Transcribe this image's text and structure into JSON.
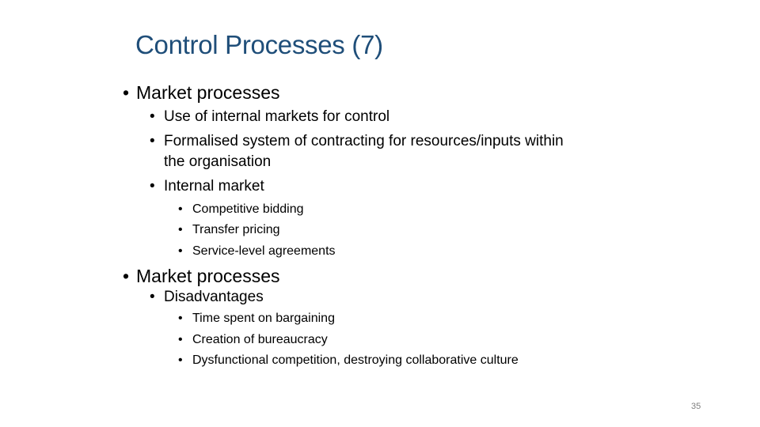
{
  "slide": {
    "title": "Control Processes (7)",
    "page_number": "35",
    "bullet_glyph": "•",
    "items": [
      {
        "level": 1,
        "text": "Market processes"
      },
      {
        "level": 2,
        "text": "Use of internal markets for control"
      },
      {
        "level": 2,
        "text": "Formalised system of contracting for resources/inputs within",
        "continuation": "the organisation"
      },
      {
        "level": 2,
        "text": "Internal market"
      },
      {
        "level": 3,
        "text": "Competitive bidding"
      },
      {
        "level": 3,
        "text": "Transfer pricing"
      },
      {
        "level": 3,
        "text": "Service-level agreements"
      },
      {
        "level": 1,
        "text": "Market processes"
      },
      {
        "level": 2,
        "text": "Disadvantages"
      },
      {
        "level": 3,
        "text": "Time spent on bargaining"
      },
      {
        "level": 3,
        "text": "Creation of bureaucracy"
      },
      {
        "level": 3,
        "text": "Dysfunctional competition, destroying collaborative culture"
      }
    ]
  }
}
